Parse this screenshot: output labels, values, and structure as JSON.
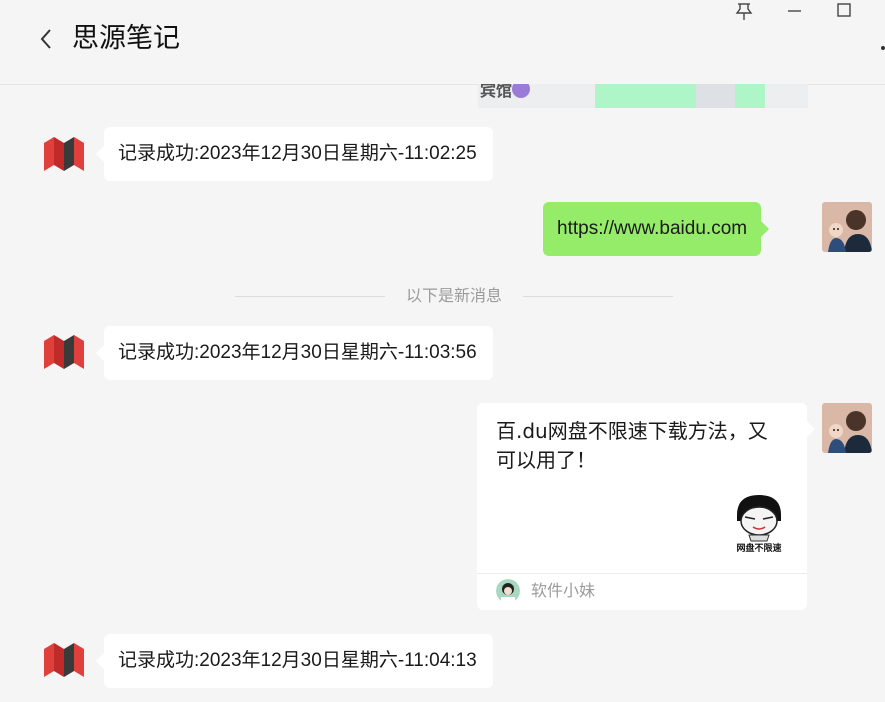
{
  "window": {
    "title": "思源笔记"
  },
  "map_fragment": {
    "label": "宾馆"
  },
  "messages": [
    {
      "direction": "in",
      "text": "记录成功:2023年12月30日星期六-11:02:25"
    },
    {
      "direction": "out",
      "text": "https://www.baidu.com"
    },
    {
      "direction": "in",
      "text": "记录成功:2023年12月30日星期六-11:03:56"
    },
    {
      "direction": "in",
      "text": "记录成功:2023年12月30日星期六-11:04:13"
    }
  ],
  "divider": {
    "text": "以下是新消息"
  },
  "card": {
    "title": "百.du网盘不限速下载方法，又可以用了！",
    "thumbnail_caption": "网盘不限速",
    "source_name": "软件小妹"
  },
  "colors": {
    "outgoing_bubble": "#95ec69",
    "incoming_bubble": "#ffffff",
    "background": "#f5f5f5",
    "logo_red": "#e0403c",
    "logo_dark": "#3a3a3a"
  },
  "icons": {
    "back": "chevron-left-icon",
    "pin": "pin-icon",
    "minimize": "minimize-icon",
    "maximize": "maximize-icon",
    "more": "more-icon"
  }
}
